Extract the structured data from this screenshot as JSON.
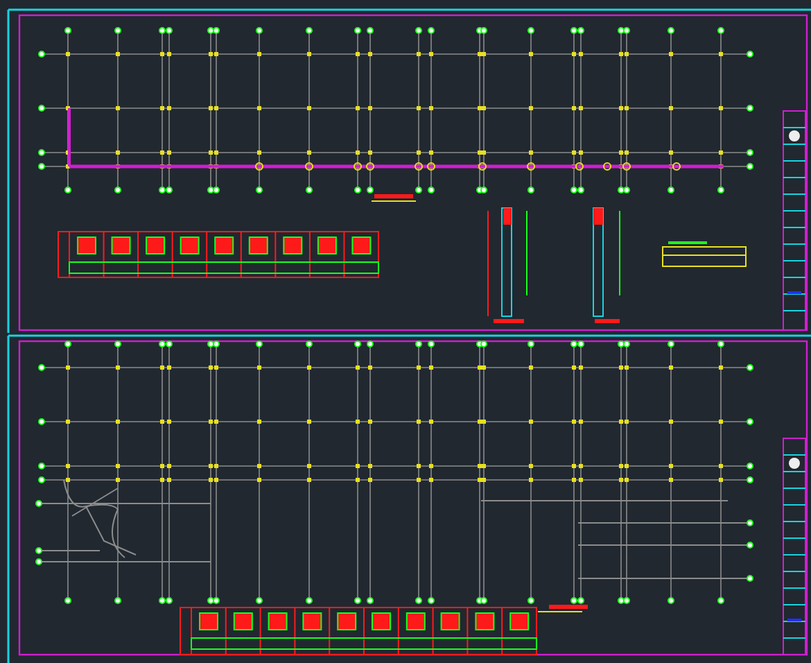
{
  "sheets": [
    {
      "kind": "plan"
    },
    {
      "kind": "curved"
    }
  ]
}
